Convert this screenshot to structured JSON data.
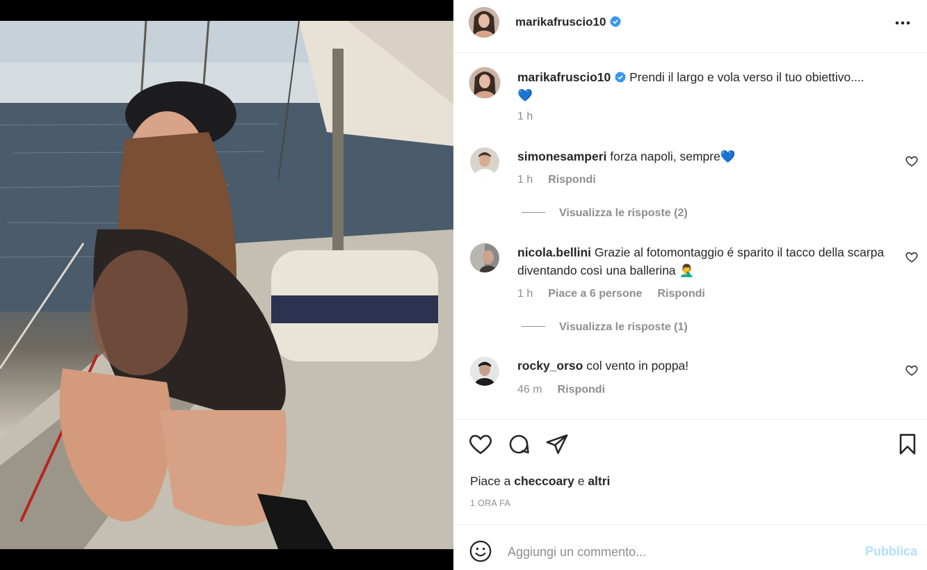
{
  "post": {
    "author": "marikafruscio10",
    "verified": true,
    "caption": "Prendi il largo e vola verso il tuo obiettivo....",
    "caption_emoji": "💙",
    "caption_time": "1 h",
    "likes_prefix": "Piace a",
    "likes_user": "checcoary",
    "likes_and": "e",
    "likes_others": "altri",
    "posted_ago": "1 ORA FA"
  },
  "comments": [
    {
      "user": "simonesamperi",
      "text": "forza napoli, sempre💙",
      "time": "1 h",
      "likes": "",
      "reply_label": "Rispondi",
      "view_replies": "Visualizza le risposte (2)"
    },
    {
      "user": "nicola.bellini",
      "text": "Grazie al fotomontaggio é sparito il tacco della scarpa diventando così una ballerina 🤦‍♂️",
      "time": "1 h",
      "likes": "Piace a 6 persone",
      "reply_label": "Rispondi",
      "view_replies": "Visualizza le risposte (1)"
    },
    {
      "user": "rocky_orso",
      "text": "col vento in poppa!",
      "time": "46 m",
      "likes": "",
      "reply_label": "Rispondi",
      "view_replies": ""
    }
  ],
  "composer": {
    "placeholder": "Aggiungi un commento...",
    "publish_label": "Pubblica"
  },
  "icons": {
    "verified": "verified-badge-icon",
    "more": "more-options-icon",
    "like": "heart-icon",
    "comment": "comment-icon",
    "share": "share-icon",
    "save": "bookmark-icon",
    "emoji": "emoji-icon"
  },
  "colors": {
    "verified": "#3897f0",
    "muted": "#8e8e8e",
    "publish_disabled": "#b2dffc"
  }
}
